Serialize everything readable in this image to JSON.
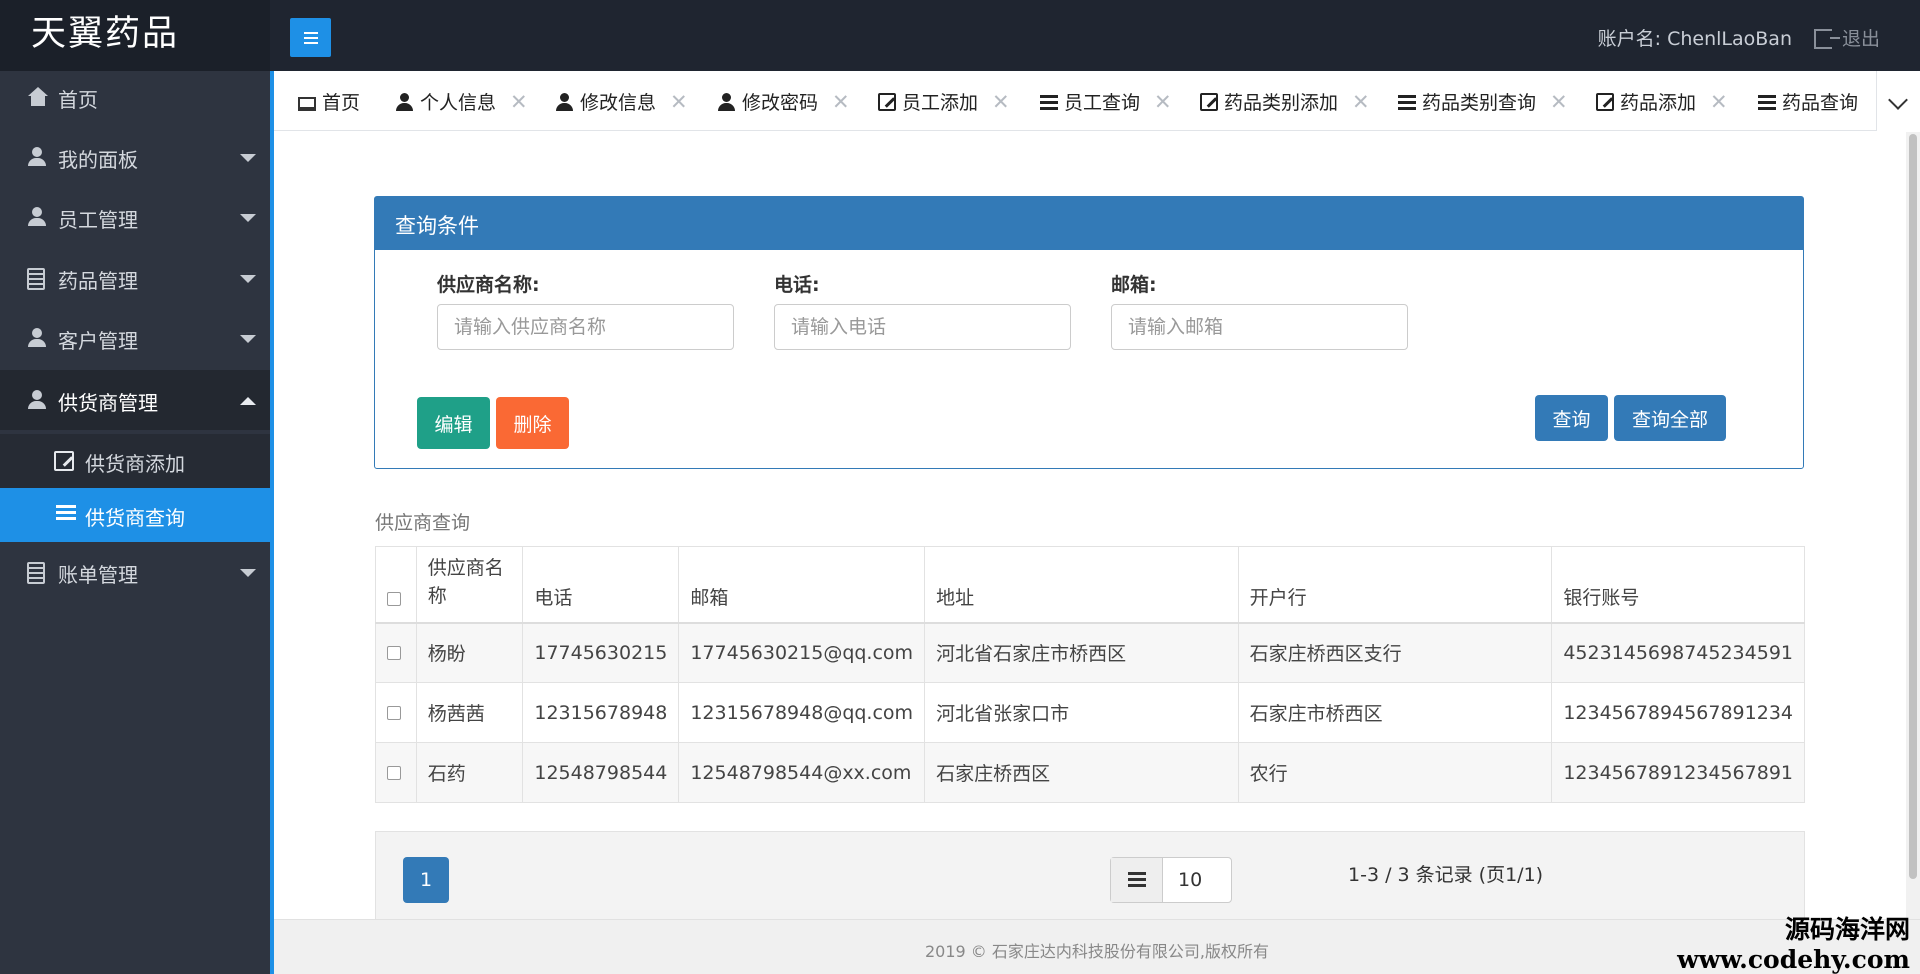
{
  "app": {
    "logo": "天翼药品",
    "account_label": "账户名:",
    "account_name": "ChenlLaoBan",
    "logout": "退出"
  },
  "sidebar": {
    "items": [
      {
        "label": "首页"
      },
      {
        "label": "我的面板"
      },
      {
        "label": "员工管理"
      },
      {
        "label": "药品管理"
      },
      {
        "label": "客户管理"
      },
      {
        "label": "供货商管理"
      },
      {
        "label": "账单管理"
      }
    ],
    "sub_items": [
      {
        "label": "供货商添加"
      },
      {
        "label": "供货商查询"
      }
    ]
  },
  "tabs": [
    {
      "label": "首页",
      "icon": "monitor-icon"
    },
    {
      "label": "个人信息",
      "icon": "user-icon"
    },
    {
      "label": "修改信息",
      "icon": "user-icon"
    },
    {
      "label": "修改密码",
      "icon": "user-lock-icon"
    },
    {
      "label": "员工添加",
      "icon": "edit-icon"
    },
    {
      "label": "员工查询",
      "icon": "list-icon"
    },
    {
      "label": "药品类别添加",
      "icon": "edit-icon"
    },
    {
      "label": "药品类别查询",
      "icon": "list-icon"
    },
    {
      "label": "药品添加",
      "icon": "edit-icon"
    },
    {
      "label": "药品查询",
      "icon": "list-icon"
    }
  ],
  "tab_close": "✕",
  "query": {
    "title": "查询条件",
    "fields": [
      {
        "label": "供应商名称:",
        "placeholder": "请输入供应商名称"
      },
      {
        "label": "电话:",
        "placeholder": "请输入电话"
      },
      {
        "label": "邮箱:",
        "placeholder": "请输入邮箱"
      }
    ],
    "buttons": {
      "edit": "编辑",
      "delete": "删除",
      "query": "查询",
      "query_all": "查询全部"
    }
  },
  "table": {
    "caption": "供应商查询",
    "columns": [
      "供应商名称",
      "电话",
      "邮箱",
      "地址",
      "开户行",
      "银行账号"
    ],
    "rows": [
      [
        "杨盼",
        "17745630215",
        "17745630215@qq.com",
        "河北省石家庄市桥西区",
        "石家庄桥西区支行",
        "4523145698745234591"
      ],
      [
        "杨茜茜",
        "12315678948",
        "12315678948@qq.com",
        "河北省张家口市",
        "石家庄市桥西区",
        "1234567894567891234"
      ],
      [
        "石药",
        "12548798544",
        "12548798544@xx.com",
        "石家庄桥西区",
        "农行",
        "1234567891234567891"
      ]
    ]
  },
  "pager": {
    "page": "1",
    "page_size": "10",
    "info": "1-3 / 3 条记录 (页1/1)"
  },
  "footer": "2019 © 石家庄达内科技股份有限公司,版权所有",
  "watermark": {
    "line1": "源码海洋网",
    "line2": "www.codehy.com"
  },
  "colors": {
    "primary": "#337ab7",
    "accent": "#1e90e6",
    "sidebar": "#2e3440",
    "header": "#1f2530",
    "edit": "#1fa088",
    "delete": "#fa6934"
  }
}
